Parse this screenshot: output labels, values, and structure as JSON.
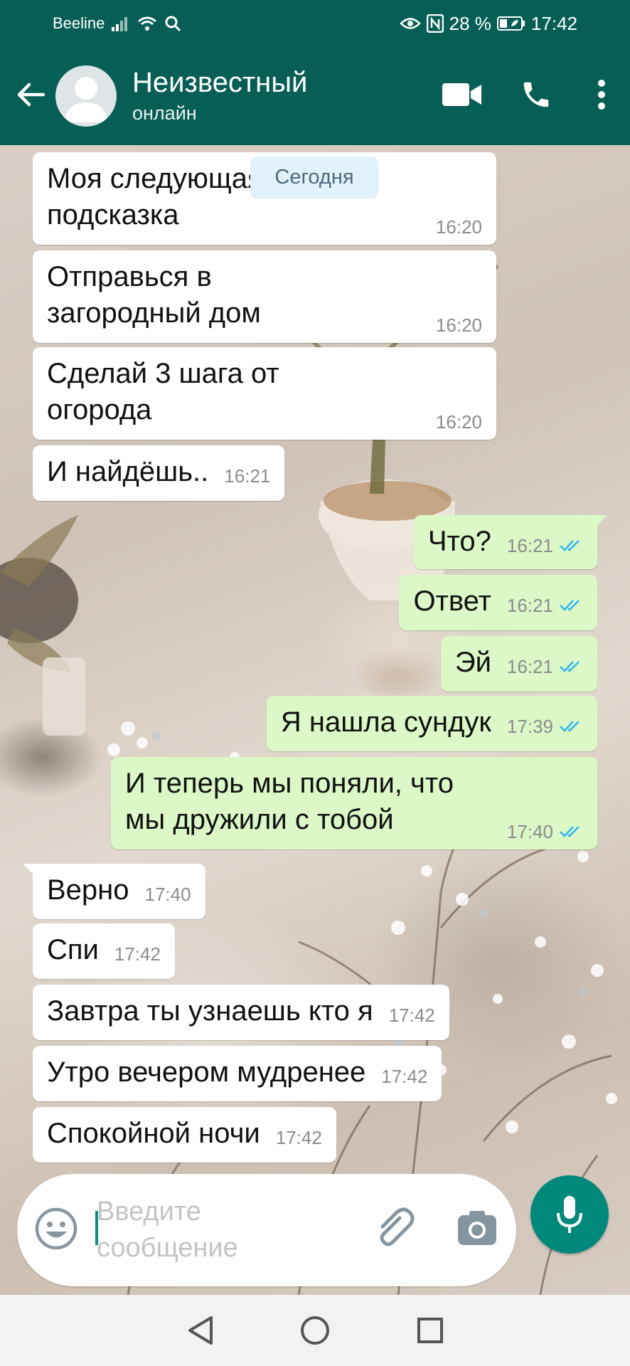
{
  "status_bar": {
    "carrier": "Beeline",
    "battery": "28 %",
    "time": "17:42"
  },
  "header": {
    "contact_name": "Неизвестный",
    "contact_status": "онлайн"
  },
  "date_chip": "Сегодня",
  "messages": [
    {
      "dir": "in",
      "text": "Моя следующая\nподсказка",
      "time": "16:20"
    },
    {
      "dir": "in",
      "text": "Отправься в\nзагородный дом",
      "time": "16:20"
    },
    {
      "dir": "in",
      "text": "Сделай 3 шага от\nогорода",
      "time": "16:20"
    },
    {
      "dir": "in",
      "text": "И найдёшь..",
      "time": "16:21"
    },
    {
      "dir": "out",
      "text": "Что?",
      "time": "16:21",
      "read": true
    },
    {
      "dir": "out",
      "text": "Ответ",
      "time": "16:21",
      "read": true
    },
    {
      "dir": "out",
      "text": "Эй",
      "time": "16:21",
      "read": true
    },
    {
      "dir": "out",
      "text": "Я нашла сундук",
      "time": "17:39",
      "read": true
    },
    {
      "dir": "out",
      "text": "И теперь мы поняли, что\nмы дружили с тобой",
      "time": "17:40",
      "read": true
    },
    {
      "dir": "in",
      "text": "Верно",
      "time": "17:40"
    },
    {
      "dir": "in",
      "text": "Спи",
      "time": "17:42"
    },
    {
      "dir": "in",
      "text": "Завтра ты узнаешь кто я",
      "time": "17:42"
    },
    {
      "dir": "in",
      "text": "Утро вечером мудренее",
      "time": "17:42"
    },
    {
      "dir": "in",
      "text": "Спокойной ночи",
      "time": "17:42"
    }
  ],
  "composer": {
    "placeholder": "Введите сообщение"
  },
  "colors": {
    "header": "#075e54",
    "outgoing_bubble": "#dcf8c6",
    "incoming_bubble": "#ffffff",
    "read_ticks": "#34b7f1",
    "mic_button": "#00897b"
  },
  "icons": {
    "back": "arrow-left-icon",
    "video": "video-camera-icon",
    "call": "phone-icon",
    "menu": "more-vert-icon",
    "emoji": "emoji-icon",
    "attach": "paperclip-icon",
    "camera": "camera-icon",
    "mic": "mic-icon"
  }
}
